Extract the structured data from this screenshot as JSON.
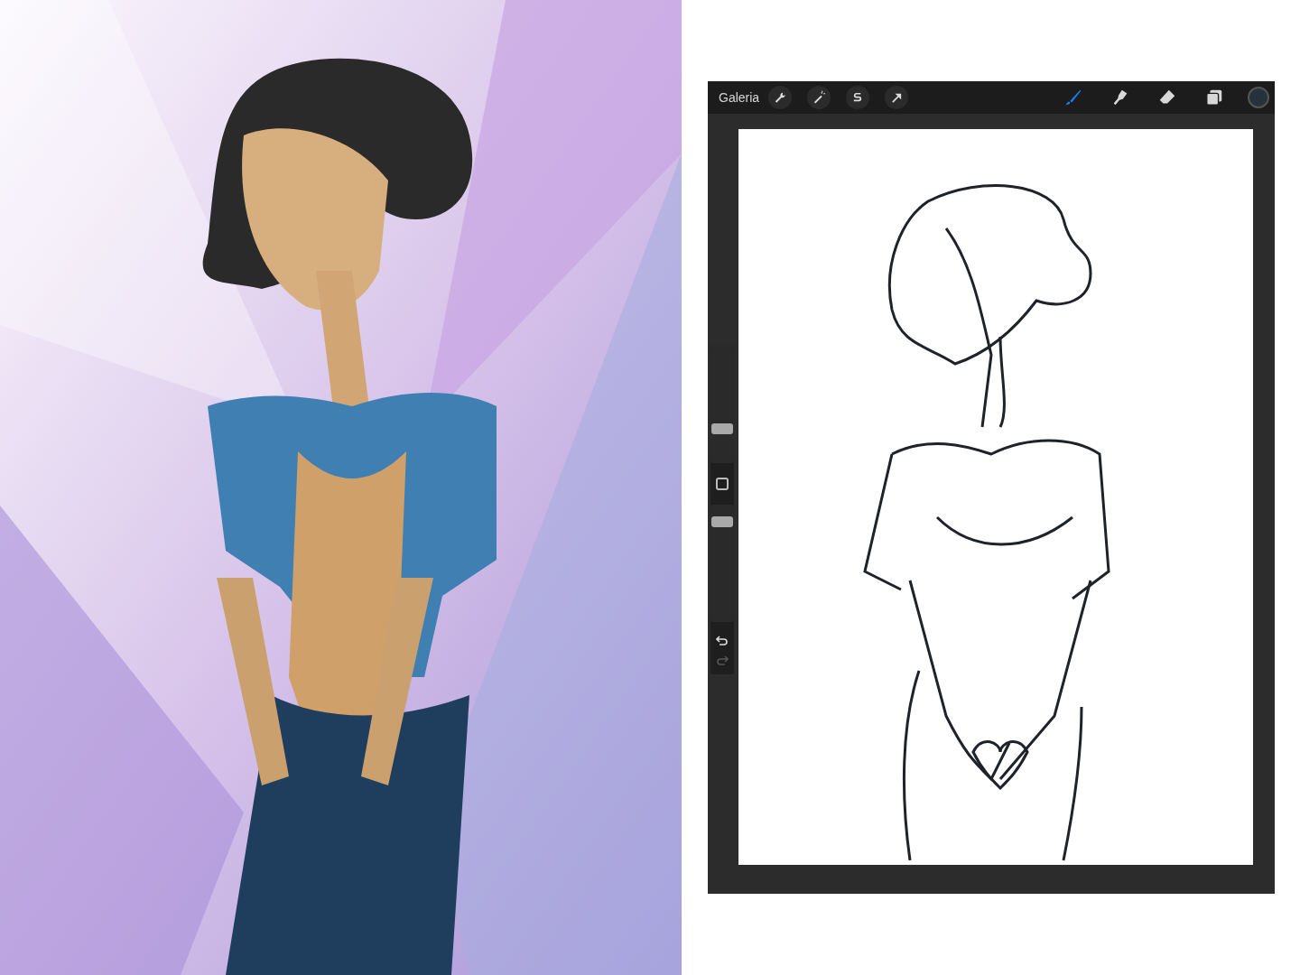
{
  "app": {
    "toolbar": {
      "gallery": "Galeria",
      "actions": [
        {
          "kind": "wrench"
        },
        {
          "kind": "wand"
        },
        {
          "kind": "selection"
        },
        {
          "kind": "transform"
        }
      ],
      "tools": [
        {
          "kind": "brush",
          "selected": true
        },
        {
          "kind": "smudge",
          "selected": false
        },
        {
          "kind": "eraser",
          "selected": false
        },
        {
          "kind": "layers",
          "selected": false
        }
      ]
    },
    "sidebar": {
      "size_slider": {
        "level": 0.27
      },
      "opacity_slider": {
        "level": 0.89
      },
      "undo": {
        "disabled": false
      },
      "redo": {
        "disabled": true
      }
    }
  }
}
